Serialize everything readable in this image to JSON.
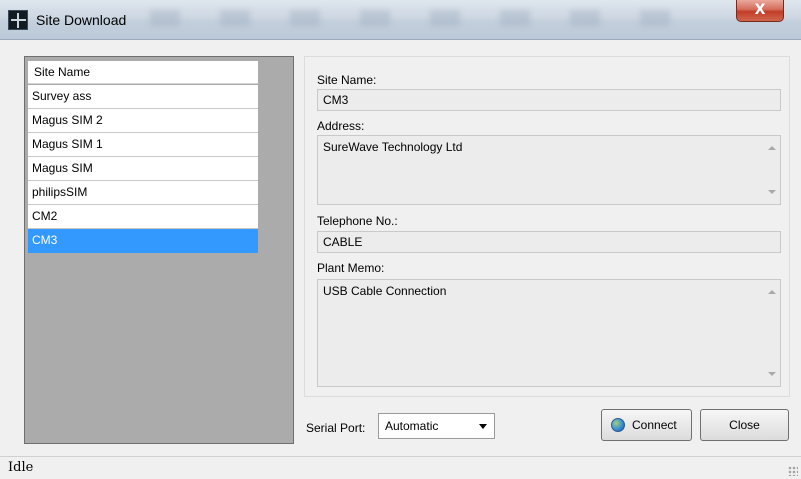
{
  "window": {
    "title": "Site Download",
    "close_glyph": "X"
  },
  "site_list": {
    "header": "Site Name",
    "items": [
      {
        "label": "Survey ass"
      },
      {
        "label": "Magus SIM 2"
      },
      {
        "label": "Magus SIM 1"
      },
      {
        "label": "Magus SIM"
      },
      {
        "label": "philipsSIM"
      },
      {
        "label": "CM2"
      },
      {
        "label": "CM3",
        "selected": true
      }
    ]
  },
  "details": {
    "site_name_label": "Site Name:",
    "site_name_value": "CM3",
    "address_label": "Address:",
    "address_value": "SureWave Technology Ltd",
    "telephone_label": "Telephone No.:",
    "telephone_value": "CABLE",
    "plant_memo_label": "Plant Memo:",
    "plant_memo_value": "USB Cable Connection"
  },
  "controls": {
    "serial_port_label": "Serial Port:",
    "serial_port_value": "Automatic",
    "connect_label": "Connect",
    "close_label": "Close"
  },
  "statusbar": {
    "text": "Idle"
  },
  "colors": {
    "selection": "#3399ff",
    "list_background": "#ababab",
    "close_button": "#c23d28"
  }
}
